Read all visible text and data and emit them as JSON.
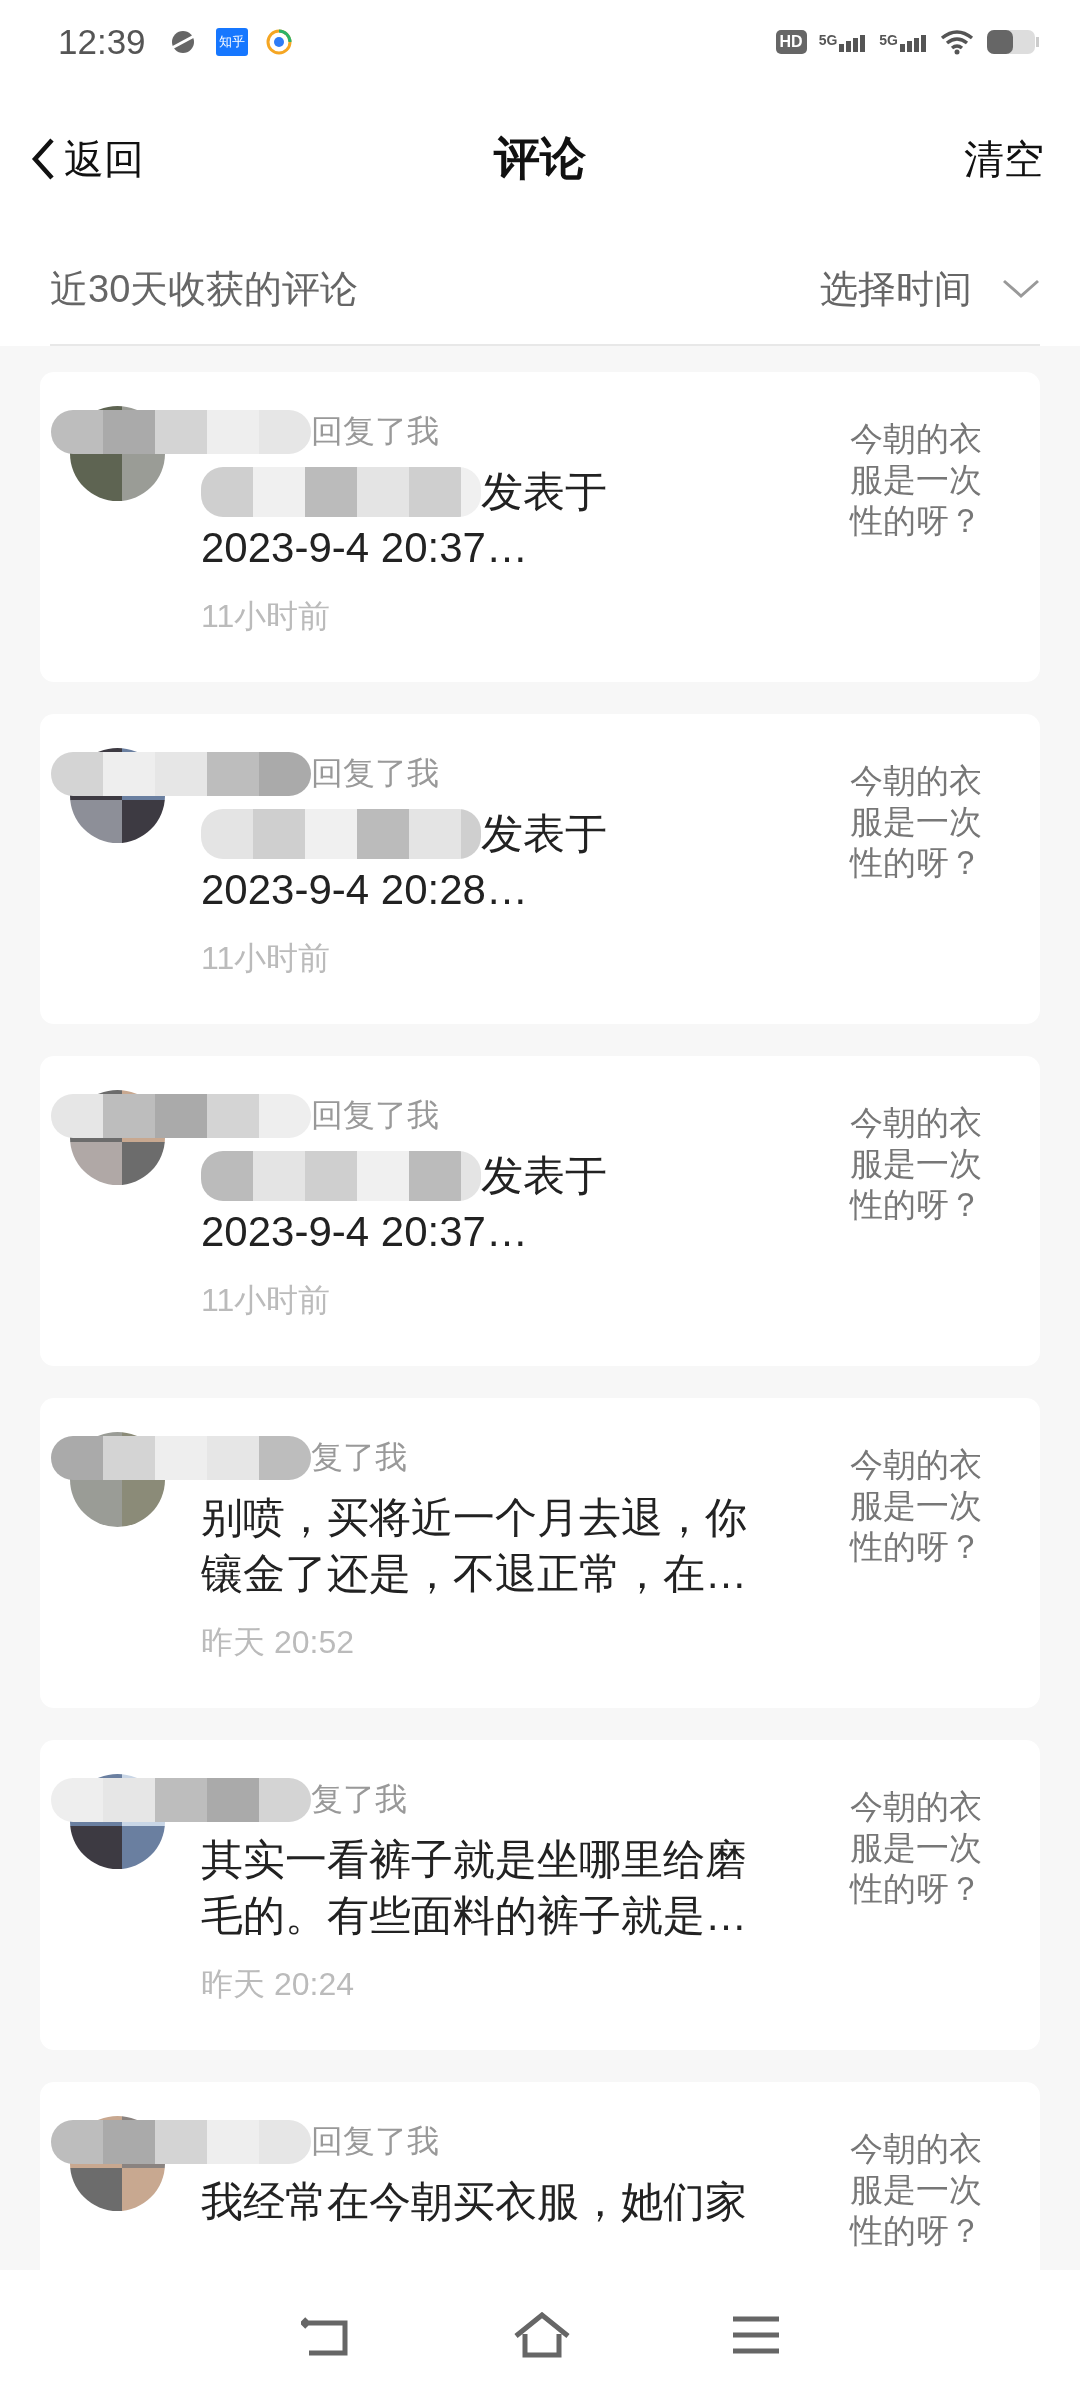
{
  "status_bar": {
    "time": "12:39",
    "app_badge": "知乎",
    "hd_label": "HD",
    "sim_slots": [
      {
        "label": "5G"
      },
      {
        "label": "5G"
      }
    ]
  },
  "app_bar": {
    "back": "返回",
    "title": "评论",
    "action": "清空"
  },
  "filter": {
    "label": "近30天收获的评论",
    "picker": "选择时间"
  },
  "comments": [
    {
      "header": "回复了我",
      "lines": [
        {
          "kind": "masked",
          "text": "发表于"
        },
        {
          "kind": "plain",
          "text": "2023-9-4 20:37…"
        }
      ],
      "time": "11小时前",
      "post": "今朝的衣服是一次性的呀？"
    },
    {
      "header": "回复了我",
      "lines": [
        {
          "kind": "masked",
          "text": "发表于"
        },
        {
          "kind": "plain",
          "text": "2023-9-4 20:28…"
        }
      ],
      "time": "11小时前",
      "post": "今朝的衣服是一次性的呀？"
    },
    {
      "header": "回复了我",
      "lines": [
        {
          "kind": "masked",
          "text": "发表于"
        },
        {
          "kind": "plain",
          "text": "2023-9-4 20:37…"
        }
      ],
      "time": "11小时前",
      "post": "今朝的衣服是一次性的呀？"
    },
    {
      "header": "复了我",
      "lines": [
        {
          "kind": "plain",
          "text": "别喷，买将近一个月去退，你"
        },
        {
          "kind": "plain",
          "text": "镶金了还是，不退正常，在…"
        }
      ],
      "time": "昨天 20:52",
      "post": "今朝的衣服是一次性的呀？"
    },
    {
      "header": "复了我",
      "lines": [
        {
          "kind": "plain",
          "text": "其实一看裤子就是坐哪里给磨"
        },
        {
          "kind": "plain",
          "text": "毛的。有些面料的裤子就是…"
        }
      ],
      "time": "昨天 20:24",
      "post": "今朝的衣服是一次性的呀？"
    },
    {
      "header": "回复了我",
      "lines": [
        {
          "kind": "plain",
          "text": "我经常在今朝买衣服，她们家"
        }
      ],
      "post": "今朝的衣服是一次性的呀？"
    }
  ]
}
